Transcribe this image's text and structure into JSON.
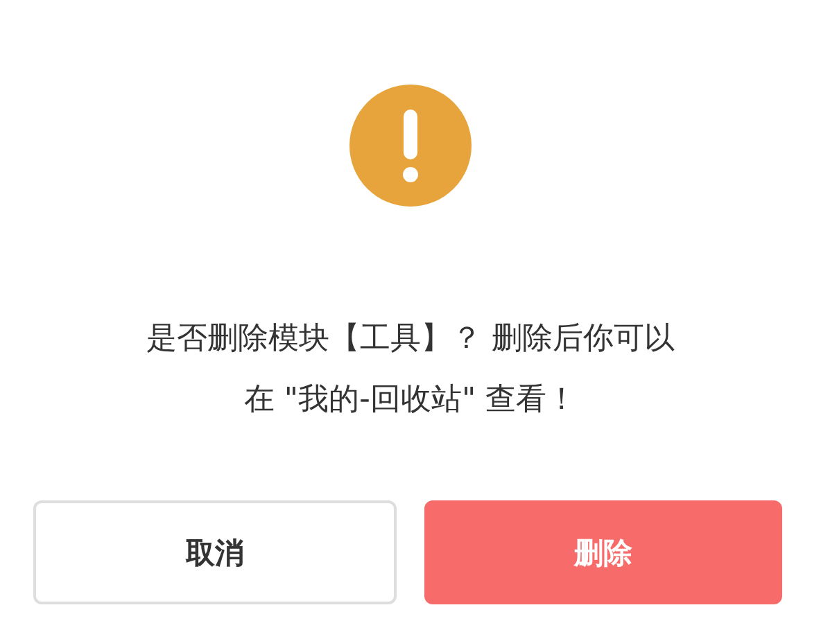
{
  "dialog": {
    "message_lines": [
      "是否删除模块【工具】？ 删除后你可以",
      "在 \"我的-回收站\" 查看！"
    ],
    "buttons": [
      {
        "label": "取消",
        "kind": "secondary"
      },
      {
        "label": "删除",
        "kind": "danger"
      }
    ]
  }
}
